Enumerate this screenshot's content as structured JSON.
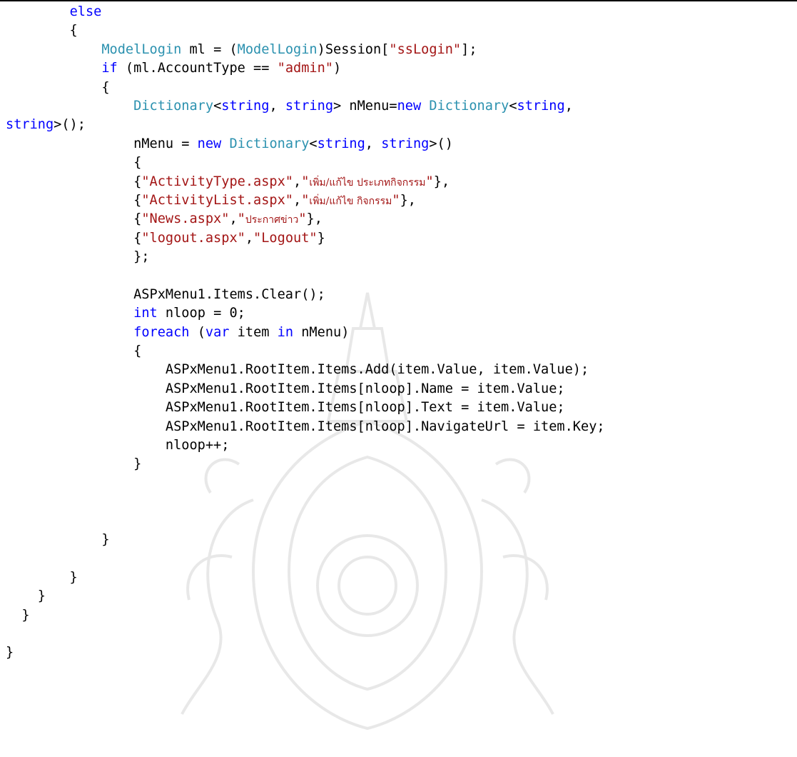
{
  "document": {
    "code_lines": [
      [
        [
          "",
          "        "
        ],
        [
          "kw",
          "else"
        ]
      ],
      [
        [
          "",
          "        {"
        ]
      ],
      [
        [
          "",
          "            "
        ],
        [
          "ty",
          "ModelLogin"
        ],
        [
          "",
          " ml = ("
        ],
        [
          "ty",
          "ModelLogin"
        ],
        [
          "",
          ")Session["
        ],
        [
          "st",
          "\"ssLogin\""
        ],
        [
          "",
          "];"
        ]
      ],
      [
        [
          "",
          "            "
        ],
        [
          "kw",
          "if"
        ],
        [
          "",
          " (ml.AccountType == "
        ],
        [
          "st",
          "\"admin\""
        ],
        [
          "",
          ")"
        ]
      ],
      [
        [
          "",
          "            {"
        ]
      ],
      [
        [
          "",
          "                "
        ],
        [
          "ty",
          "Dictionary"
        ],
        [
          "",
          "<"
        ],
        [
          "kw",
          "string"
        ],
        [
          "",
          ", "
        ],
        [
          "kw",
          "string"
        ],
        [
          "",
          "> nMenu="
        ],
        [
          "kw",
          "new"
        ],
        [
          "",
          " "
        ],
        [
          "ty",
          "Dictionary"
        ],
        [
          "",
          "<"
        ],
        [
          "kw",
          "string"
        ],
        [
          "",
          ","
        ]
      ],
      [
        [
          "kw",
          "string"
        ],
        [
          "",
          ">();"
        ]
      ],
      [
        [
          "",
          "                nMenu = "
        ],
        [
          "kw",
          "new"
        ],
        [
          "",
          " "
        ],
        [
          "ty",
          "Dictionary"
        ],
        [
          "",
          "<"
        ],
        [
          "kw",
          "string"
        ],
        [
          "",
          ", "
        ],
        [
          "kw",
          "string"
        ],
        [
          "",
          ">()"
        ]
      ],
      [
        [
          "",
          "                {"
        ]
      ],
      [
        [
          "",
          "                {"
        ],
        [
          "st",
          "\"ActivityType.aspx\""
        ],
        [
          "",
          ","
        ],
        [
          "st",
          "\""
        ],
        [
          "stth",
          "เพิ่ม/แก้ไข ประเภทกิจกรรม"
        ],
        [
          "st",
          "\""
        ],
        [
          "",
          "},"
        ]
      ],
      [
        [
          "",
          "                {"
        ],
        [
          "st",
          "\"ActivityList.aspx\""
        ],
        [
          "",
          ","
        ],
        [
          "st",
          "\""
        ],
        [
          "stth",
          "เพิ่ม/แก้ไข กิจกรรม"
        ],
        [
          "st",
          "\""
        ],
        [
          "",
          "},"
        ]
      ],
      [
        [
          "",
          "                {"
        ],
        [
          "st",
          "\"News.aspx\""
        ],
        [
          "",
          ","
        ],
        [
          "st",
          "\""
        ],
        [
          "stth",
          "ประกาศข่าว"
        ],
        [
          "st",
          "\""
        ],
        [
          "",
          "},"
        ]
      ],
      [
        [
          "",
          "                {"
        ],
        [
          "st",
          "\"logout.aspx\""
        ],
        [
          "",
          ","
        ],
        [
          "st",
          "\"Logout\""
        ],
        [
          "",
          "}"
        ]
      ],
      [
        [
          "",
          "                };"
        ]
      ],
      [],
      [
        [
          "",
          "                ASPxMenu1.Items.Clear();"
        ]
      ],
      [
        [
          "",
          "                "
        ],
        [
          "kw",
          "int"
        ],
        [
          "",
          " nloop = 0;"
        ]
      ],
      [
        [
          "",
          "                "
        ],
        [
          "kw",
          "foreach"
        ],
        [
          "",
          " ("
        ],
        [
          "kw",
          "var"
        ],
        [
          "",
          " item "
        ],
        [
          "kw",
          "in"
        ],
        [
          "",
          " nMenu)"
        ]
      ],
      [
        [
          "",
          "                {"
        ]
      ],
      [
        [
          "",
          "                    ASPxMenu1.RootItem.Items.Add(item.Value, item.Value);"
        ]
      ],
      [
        [
          "",
          "                    ASPxMenu1.RootItem.Items[nloop].Name = item.Value;"
        ]
      ],
      [
        [
          "",
          "                    ASPxMenu1.RootItem.Items[nloop].Text = item.Value;"
        ]
      ],
      [
        [
          "",
          "                    ASPxMenu1.RootItem.Items[nloop].NavigateUrl = item.Key;"
        ]
      ],
      [
        [
          "",
          "                    nloop++;"
        ]
      ],
      [
        [
          "",
          "                }"
        ]
      ],
      [],
      [],
      [],
      [
        [
          "",
          "            }"
        ]
      ],
      [],
      [
        [
          "",
          "        }"
        ]
      ],
      [
        [
          "",
          "    }"
        ]
      ],
      [
        [
          "",
          "  }"
        ]
      ],
      [],
      [
        [
          "",
          "}"
        ]
      ]
    ]
  },
  "colors": {
    "keyword": "#0000ff",
    "type": "#2b91af",
    "string": "#a31515",
    "text": "#000000"
  },
  "watermark": {
    "icon": "university-emblem-watermark"
  }
}
